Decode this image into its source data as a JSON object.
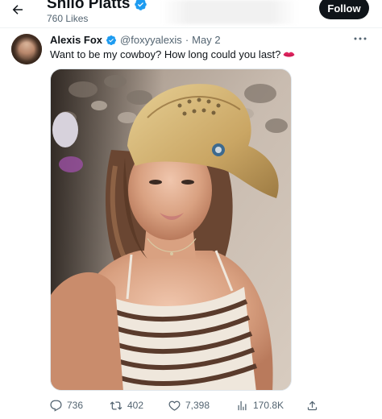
{
  "header": {
    "title": "Shilo Platts",
    "likes": "760 Likes",
    "follow_label": "Follow"
  },
  "tweet": {
    "display_name": "Alexis Fox",
    "handle": "@foxyyalexis",
    "separator": "·",
    "date": "May 2",
    "text": "Want to be my cowboy? How long could you last?",
    "emoji_icon": "lips-icon"
  },
  "actions": {
    "replies": "736",
    "reposts": "402",
    "likes": "7,398",
    "views": "170.8K"
  },
  "colors": {
    "verified": "#1d9bf0",
    "follow_bg": "#0f1419",
    "muted_text": "#536471",
    "lips": "#e0245e"
  },
  "icons": [
    "back-arrow-icon",
    "verified-badge-icon",
    "more-icon",
    "reply-icon",
    "repost-icon",
    "like-icon",
    "views-icon",
    "share-icon"
  ]
}
